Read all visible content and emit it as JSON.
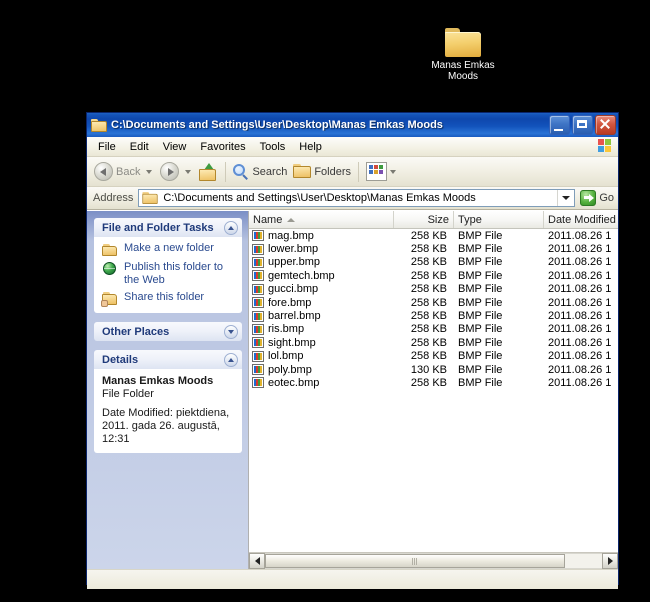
{
  "desktop": {
    "icon": {
      "name": "folder-icon",
      "label": "Manas Emkas Moods"
    },
    "background_color": "#000000"
  },
  "window": {
    "title": "C:\\Documents and Settings\\User\\Desktop\\Manas Emkas Moods",
    "title_icon": "folder-icon",
    "titlebar_color": "#0e47ad",
    "controls": {
      "minimize": "_",
      "maximize": "□",
      "close": "X"
    }
  },
  "menu": {
    "items": [
      {
        "label": "File"
      },
      {
        "label": "Edit"
      },
      {
        "label": "View"
      },
      {
        "label": "Favorites"
      },
      {
        "label": "Tools"
      },
      {
        "label": "Help"
      }
    ],
    "flag_icon": "windows-flag-icon"
  },
  "toolbar": {
    "back_label": "Back",
    "forward_label": "",
    "up_label": "",
    "search_label": "Search",
    "folders_label": "Folders",
    "views_label": ""
  },
  "address": {
    "label": "Address",
    "value": "C:\\Documents and Settings\\User\\Desktop\\Manas Emkas Moods",
    "go_label": "Go"
  },
  "sidebar": {
    "panels": [
      {
        "title": "File and Folder Tasks",
        "collapsed": false,
        "tasks": [
          {
            "icon": "new-folder-icon",
            "label": "Make a new folder"
          },
          {
            "icon": "globe-icon",
            "label": "Publish this folder to the Web"
          },
          {
            "icon": "share-folder-icon",
            "label": "Share this folder"
          }
        ]
      },
      {
        "title": "Other Places",
        "collapsed": true,
        "tasks": []
      },
      {
        "title": "Details",
        "collapsed": false,
        "details": {
          "name": "Manas Emkas Moods",
          "type": "File Folder",
          "date_modified": "Date Modified: piektdiena, 2011. gada 26. augustā, 12:31"
        }
      }
    ]
  },
  "file_list": {
    "columns": [
      {
        "key": "name",
        "label": "Name",
        "sorted": true,
        "sort_dir": "asc"
      },
      {
        "key": "size",
        "label": "Size",
        "sorted": false
      },
      {
        "key": "type",
        "label": "Type",
        "sorted": false
      },
      {
        "key": "date",
        "label": "Date Modified",
        "sorted": false
      }
    ],
    "rows": [
      {
        "icon": "bmp-file-icon",
        "name": "mag.bmp",
        "size": "258 KB",
        "type": "BMP File",
        "date": "2011.08.26 1"
      },
      {
        "icon": "bmp-file-icon",
        "name": "lower.bmp",
        "size": "258 KB",
        "type": "BMP File",
        "date": "2011.08.26 1"
      },
      {
        "icon": "bmp-file-icon",
        "name": "upper.bmp",
        "size": "258 KB",
        "type": "BMP File",
        "date": "2011.08.26 1"
      },
      {
        "icon": "bmp-file-icon",
        "name": "gemtech.bmp",
        "size": "258 KB",
        "type": "BMP File",
        "date": "2011.08.26 1"
      },
      {
        "icon": "bmp-file-icon",
        "name": "gucci.bmp",
        "size": "258 KB",
        "type": "BMP File",
        "date": "2011.08.26 1"
      },
      {
        "icon": "bmp-file-icon",
        "name": "fore.bmp",
        "size": "258 KB",
        "type": "BMP File",
        "date": "2011.08.26 1"
      },
      {
        "icon": "bmp-file-icon",
        "name": "barrel.bmp",
        "size": "258 KB",
        "type": "BMP File",
        "date": "2011.08.26 1"
      },
      {
        "icon": "bmp-file-icon",
        "name": "ris.bmp",
        "size": "258 KB",
        "type": "BMP File",
        "date": "2011.08.26 1"
      },
      {
        "icon": "bmp-file-icon",
        "name": "sight.bmp",
        "size": "258 KB",
        "type": "BMP File",
        "date": "2011.08.26 1"
      },
      {
        "icon": "bmp-file-icon",
        "name": "lol.bmp",
        "size": "258 KB",
        "type": "BMP File",
        "date": "2011.08.26 1"
      },
      {
        "icon": "bmp-file-icon",
        "name": "poly.bmp",
        "size": "130 KB",
        "type": "BMP File",
        "date": "2011.08.26 1"
      },
      {
        "icon": "bmp-file-icon",
        "name": "eotec.bmp",
        "size": "258 KB",
        "type": "BMP File",
        "date": "2011.08.26 1"
      }
    ]
  },
  "status": {
    "text": ""
  }
}
